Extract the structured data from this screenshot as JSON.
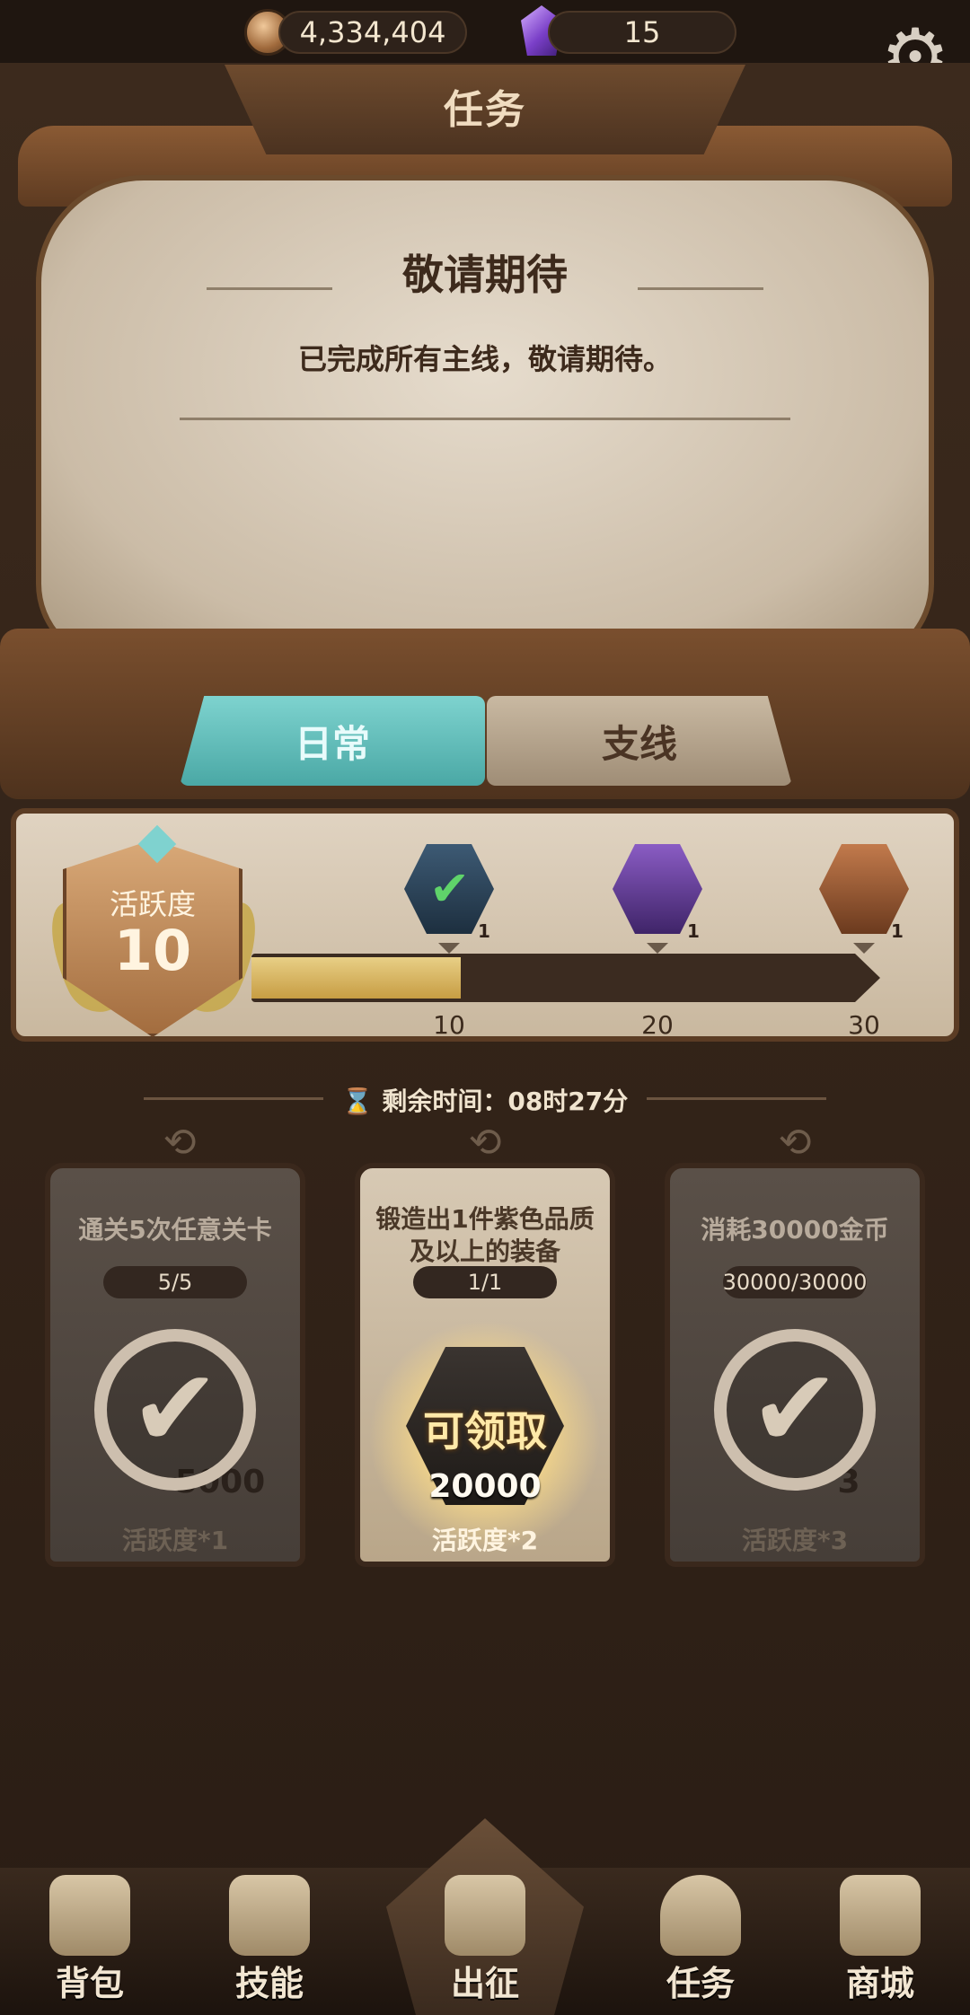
{
  "resources": {
    "coins": "4,334,404",
    "gems": "15"
  },
  "header": {
    "title": "任务"
  },
  "notice": {
    "heading": "敬请期待",
    "body": "已完成所有主线，敬请期待。"
  },
  "tabs": [
    {
      "label": "日常",
      "active": true
    },
    {
      "label": "支线",
      "active": false
    }
  ],
  "activity": {
    "label": "活跃度",
    "value": "10",
    "progress_fraction": 0.333,
    "milestones": [
      {
        "tick": "10",
        "chest": "green-check-chest",
        "count": "1",
        "claimed": true
      },
      {
        "tick": "20",
        "chest": "purple-chest",
        "count": "1",
        "claimed": false
      },
      {
        "tick": "30",
        "chest": "bronze-chest",
        "count": "1",
        "claimed": false
      }
    ]
  },
  "timer": {
    "text": "剩余时间：08时27分"
  },
  "quests": [
    {
      "title": "通关5次任意关卡",
      "progress": "5/5",
      "amount": "5000",
      "activity": "活跃度*1",
      "state": "done"
    },
    {
      "title": "锻造出1件紫色品质及以上的装备",
      "progress": "1/1",
      "amount": "20000",
      "activity": "活跃度*2",
      "state": "claimable",
      "claim_label": "可领取"
    },
    {
      "title": "消耗30000金币",
      "progress": "30000/30000",
      "amount": "3",
      "activity": "活跃度*3",
      "state": "done"
    }
  ],
  "nav": [
    {
      "label": "背包",
      "icon": "bag-icon"
    },
    {
      "label": "技能",
      "icon": "skill-book-icon"
    },
    {
      "label": "出征",
      "icon": "sword-map-icon"
    },
    {
      "label": "任务",
      "icon": "horn-icon"
    },
    {
      "label": "商城",
      "icon": "crown-shop-icon"
    }
  ],
  "colors": {
    "tab_active": "#5bb9b6",
    "progress_fill": "#d4b05c",
    "claim_text": "#ffe9a8"
  }
}
